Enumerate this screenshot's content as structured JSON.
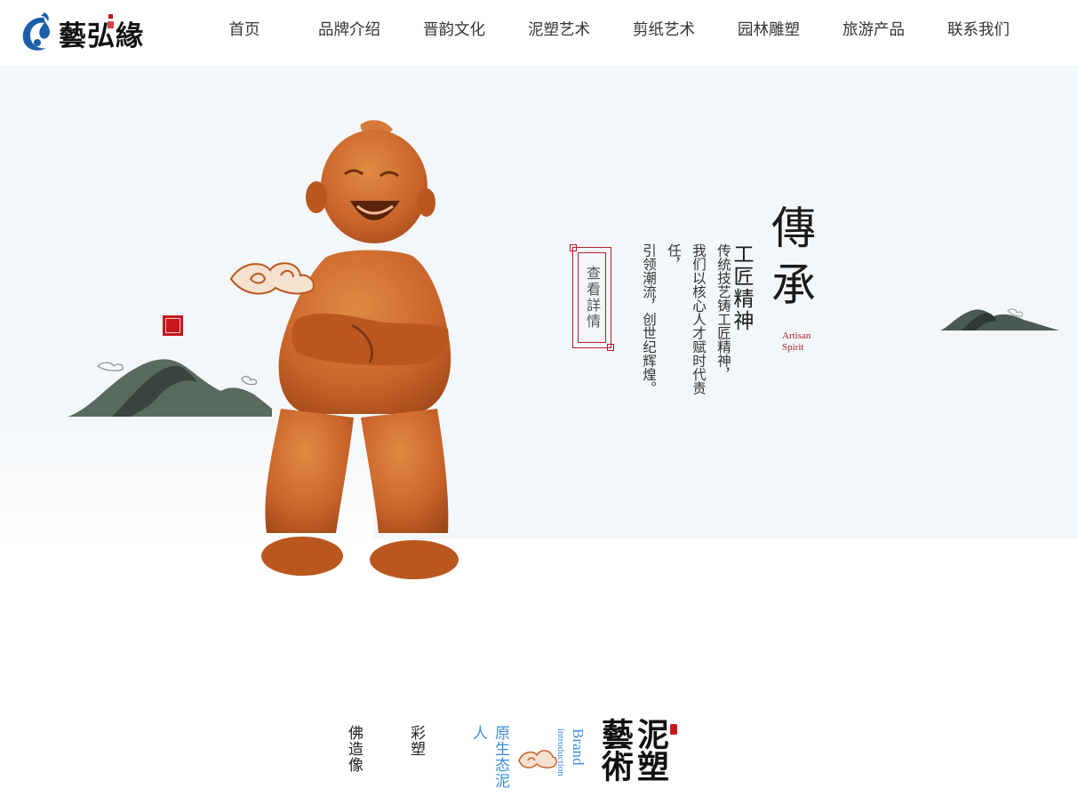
{
  "header": {
    "logo_text": "藝弘緣",
    "nav": [
      "首页",
      "品牌介绍",
      "晋韵文化",
      "泥塑艺术",
      "剪纸艺术",
      "园林雕塑",
      "旅游产品",
      "联系我们"
    ]
  },
  "hero": {
    "title": "傳承",
    "title_en": "Artisan Spirit",
    "subtitle": "工匠精神",
    "desc_lines": [
      "传统技艺铸工匠精神，",
      "我们以核心人才赋时代责任，",
      "引领潮流，创世纪辉煌。"
    ],
    "detail_button": "查看詳情"
  },
  "intro": {
    "categories": [
      "佛造像",
      "彩塑",
      "原生态泥人"
    ],
    "brand_en_1": "Brand",
    "brand_en_2": "introduction",
    "brand_title": "泥塑藝術"
  },
  "colors": {
    "accent_red": "#b51f24",
    "accent_blue": "#3b8ee0",
    "hero_bg": "#f3f7fa",
    "clay": "#c9642a"
  }
}
